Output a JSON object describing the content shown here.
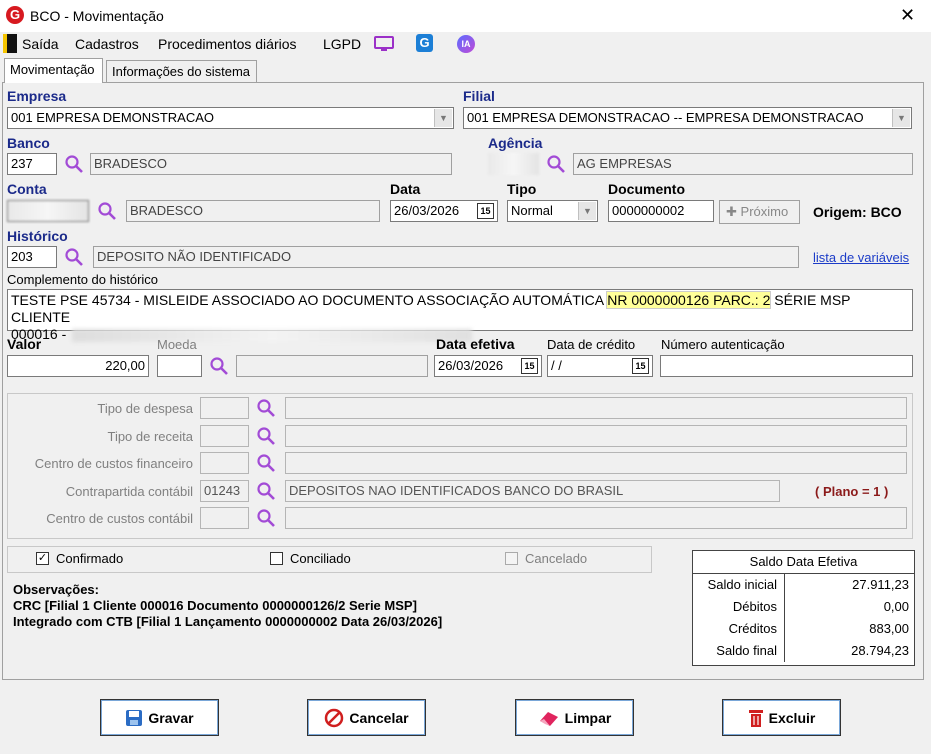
{
  "window": {
    "title": "BCO - Movimentação",
    "app_letter": "G",
    "close": "✕"
  },
  "menu": {
    "saida": "Saída",
    "cadastros": "Cadastros",
    "procedimentos": "Procedimentos diários",
    "lgpd": "LGPD",
    "ia": "IA"
  },
  "tabs": [
    "Movimentação",
    "Informações do sistema"
  ],
  "form": {
    "empresa_label": "Empresa",
    "empresa_value": "001 EMPRESA DEMONSTRACAO",
    "filial_label": "Filial",
    "filial_value": "001 EMPRESA DEMONSTRACAO -- EMPRESA DEMONSTRACAO",
    "banco_label": "Banco",
    "banco_code": "237",
    "banco_name": "BRADESCO",
    "agencia_label": "Agência",
    "agencia_name": "AG EMPRESAS",
    "conta_label": "Conta",
    "conta_name": "BRADESCO",
    "data_label": "Data",
    "data_value": "26/03/2026",
    "tipo_label": "Tipo",
    "tipo_value": "Normal",
    "documento_label": "Documento",
    "documento_value": "0000000002",
    "proximo_label": "Próximo",
    "origem": "Origem: BCO",
    "historico_label": "Histórico",
    "historico_code": "203",
    "historico_name": "DEPOSITO NÃO IDENTIFICADO",
    "lista_variaveis": "lista de variáveis",
    "complemento_label": "Complemento do histórico",
    "complemento_part1": "TESTE PSE 45734 - MISLEIDE  ASSOCIADO AO DOCUMENTO ASSOCIAÇÃO AUTOMÁTICA ",
    "complemento_highlight": "NR 0000000126 PARC.: 2",
    "complemento_part2": " SÉRIE MSP CLIENTE",
    "complemento_line2": "000016 -",
    "valor_label": "Valor",
    "valor_value": "220,00",
    "moeda_label": "Moeda",
    "data_efetiva_label": "Data efetiva",
    "data_efetiva_value": "26/03/2026",
    "data_credito_label": "Data de crédito",
    "data_credito_value": " / /",
    "numero_autenticacao_label": "Número autenticação"
  },
  "group": {
    "tipo_despesa": "Tipo de despesa",
    "tipo_receita": "Tipo de receita",
    "centro_custos_fin": "Centro de custos financeiro",
    "contrapartida": "Contrapartida contábil",
    "contrapartida_code": "01243",
    "contrapartida_name": "DEPOSITOS NAO IDENTIFICADOS BANCO DO BRASIL",
    "plano": "( Plano = 1 )",
    "centro_custos_cont": "Centro de custos contábil"
  },
  "status": {
    "confirmado": "Confirmado",
    "conciliado": "Conciliado",
    "cancelado": "Cancelado"
  },
  "observacoes": {
    "title": "Observações:",
    "line1": "CRC [Filial 1 Cliente 000016 Documento 0000000126/2 Serie MSP]",
    "line2": "Integrado com CTB [Filial 1 Lançamento 0000000002 Data 26/03/2026]"
  },
  "saldo": {
    "title": "Saldo Data Efetiva",
    "rows": [
      {
        "label": "Saldo inicial",
        "value": "27.911,23"
      },
      {
        "label": "Débitos",
        "value": "0,00"
      },
      {
        "label": "Créditos",
        "value": "883,00"
      },
      {
        "label": "Saldo final",
        "value": "28.794,23"
      }
    ]
  },
  "buttons": {
    "gravar": "Gravar",
    "cancelar": "Cancelar",
    "limpar": "Limpar",
    "excluir": "Excluir"
  },
  "colors": {
    "accent_blue": "#1b2a8a",
    "plano_red": "#8b1a1a",
    "highlight": "#ffff99",
    "icon_purple": "#a24bd6"
  }
}
